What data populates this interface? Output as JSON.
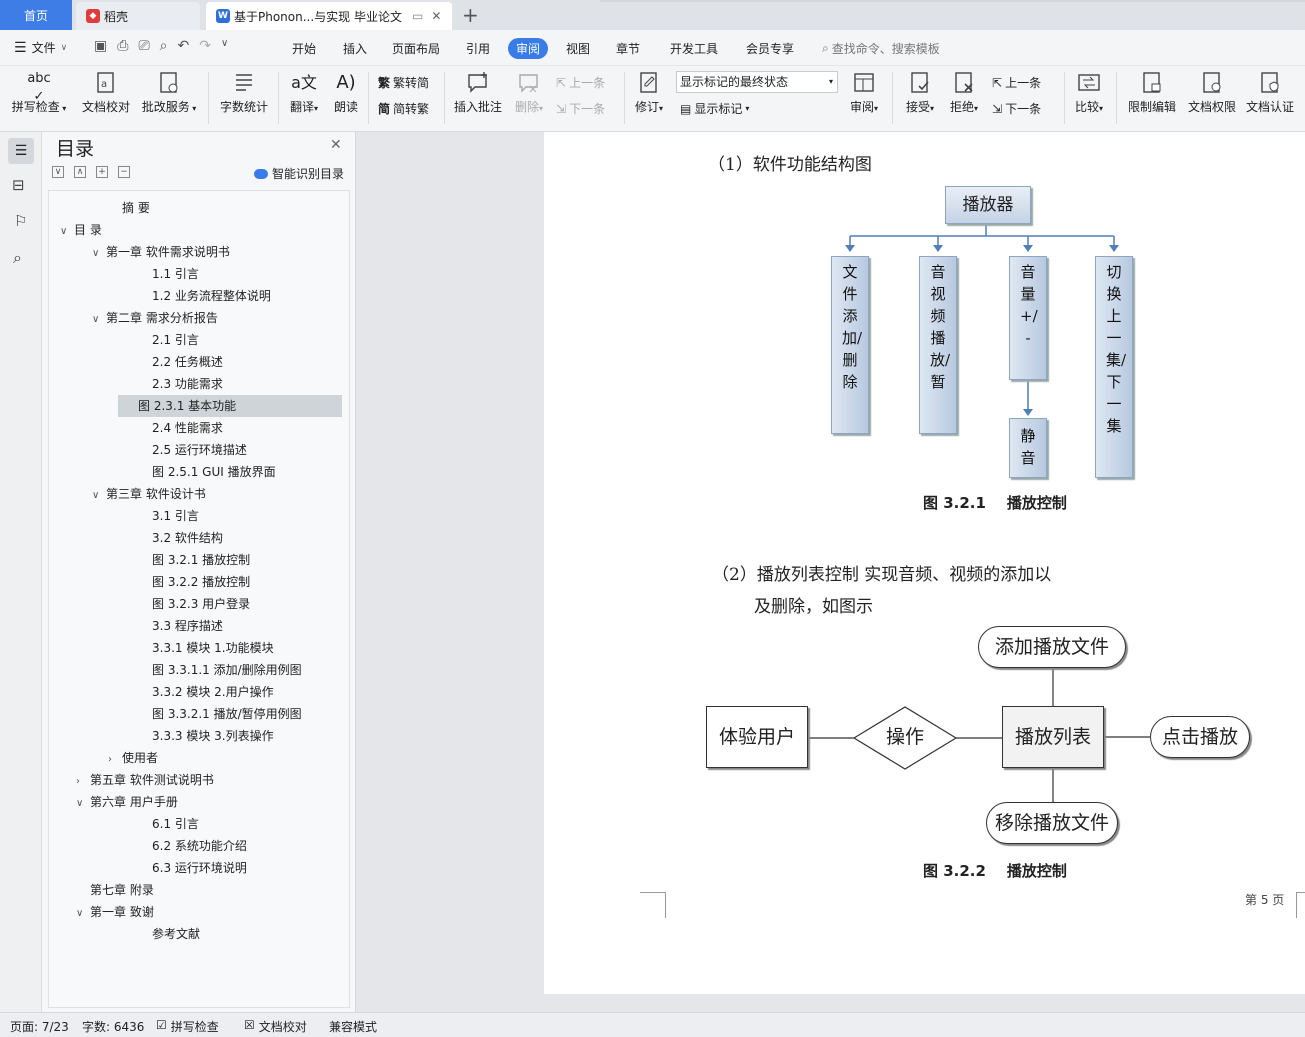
{
  "tabs": [
    {
      "label": "首页"
    },
    {
      "label": "稻壳"
    },
    {
      "label": "基于Phonon...与实现 毕业论文"
    }
  ],
  "menu": {
    "file": "文件",
    "items": [
      "开始",
      "插入",
      "页面布局",
      "引用",
      "审阅",
      "视图",
      "章节",
      "开发工具",
      "会员专享"
    ],
    "active": "审阅",
    "search_placeholder": "查找命令、搜索模板"
  },
  "ribbon": {
    "spellcheck": "拼写检查",
    "doc_check": "文档校对",
    "annotate_service": "批改服务",
    "word_count": "字数统计",
    "translate": "翻译",
    "read_aloud": "朗读",
    "trad_to_simp": "繁转简",
    "simp_to_trad": "简转繁",
    "insert_comment": "插入批注",
    "delete": "删除",
    "prev": "上一条",
    "next": "下一条",
    "revise": "修订",
    "markup_state": "显示标记的最终状态",
    "show_markup": "显示标记",
    "review": "审阅",
    "accept": "接受",
    "reject": "拒绝",
    "prev2": "上一条",
    "next2": "下一条",
    "compare": "比较",
    "restrict_edit": "限制编辑",
    "doc_permission": "文档权限",
    "doc_cert": "文档认证"
  },
  "toc": {
    "title": "目录",
    "smart_label": "智能识别目录",
    "items": [
      {
        "label": "摘  要",
        "level": 2,
        "chev": ""
      },
      {
        "label": "目  录",
        "level": 0,
        "chev": "v"
      },
      {
        "label": "第一章  软件需求说明书",
        "level": 1,
        "chev": "v"
      },
      {
        "label": "1.1 引言",
        "level": 3,
        "chev": ""
      },
      {
        "label": "1.2 业务流程整体说明",
        "level": 3,
        "chev": ""
      },
      {
        "label": "第二章  需求分析报告",
        "level": 1,
        "chev": "v"
      },
      {
        "label": "2.1 引言",
        "level": 3,
        "chev": ""
      },
      {
        "label": "2.2 任务概述",
        "level": 3,
        "chev": ""
      },
      {
        "label": "2.3 功能需求",
        "level": 3,
        "chev": ""
      },
      {
        "label": "图 2.3.1  基本功能",
        "level": 3,
        "chev": "",
        "selected": true
      },
      {
        "label": "2.4 性能需求",
        "level": 3,
        "chev": ""
      },
      {
        "label": "2.5 运行环境描述",
        "level": 3,
        "chev": ""
      },
      {
        "label": "图 2.5.1  GUI 播放界面",
        "level": 3,
        "chev": ""
      },
      {
        "label": "第三章  软件设计书",
        "level": 1,
        "chev": "v"
      },
      {
        "label": "3.1 引言",
        "level": 3,
        "chev": ""
      },
      {
        "label": "3.2 软件结构",
        "level": 3,
        "chev": ""
      },
      {
        "label": "图 3.2.1  播放控制",
        "level": 3,
        "chev": ""
      },
      {
        "label": "图 3.2.2  播放控制",
        "level": 3,
        "chev": ""
      },
      {
        "label": "图 3.2.3  用户登录",
        "level": 3,
        "chev": ""
      },
      {
        "label": "3.3 程序描述",
        "level": 3,
        "chev": ""
      },
      {
        "label": "3.3.1 模块 1.功能模块",
        "level": 3,
        "chev": ""
      },
      {
        "label": "图 3.3.1.1  添加/删除用例图",
        "level": 3,
        "chev": ""
      },
      {
        "label": "3.3.2 模块 2.用户操作",
        "level": 3,
        "chev": ""
      },
      {
        "label": "图 3.3.2.1  播放/暂停用例图",
        "level": 3,
        "chev": ""
      },
      {
        "label": "3.3.3 模块 3.列表操作",
        "level": 3,
        "chev": ""
      },
      {
        "label": "使用者",
        "level": 2,
        "chev": ">"
      },
      {
        "label": "第五章  软件测试说明书",
        "level": 0.5,
        "chev": ">"
      },
      {
        "label": "第六章  用户手册",
        "level": 0.5,
        "chev": "v"
      },
      {
        "label": "6.1 引言",
        "level": 3,
        "chev": ""
      },
      {
        "label": "6.2 系统功能介绍",
        "level": 3,
        "chev": ""
      },
      {
        "label": "6.3 运行环境说明",
        "level": 3,
        "chev": ""
      },
      {
        "label": "第七章  附录",
        "level": 0.5,
        "chev": ""
      },
      {
        "label": "第一章  致谢",
        "level": 0.5,
        "chev": "v"
      },
      {
        "label": "参考文献",
        "level": 3,
        "chev": ""
      }
    ]
  },
  "document": {
    "heading1": "（1）软件功能结构图",
    "diagram1": {
      "root": "播放器",
      "children": [
        "文件添加/删除",
        "音视频播放/暂",
        "音量+/-",
        "切换上一集/下一集"
      ],
      "sub": "静音",
      "caption": "图 3.2.1    播放控制"
    },
    "heading2_line1": "（2）播放列表控制  实现音频、视频的添加以",
    "heading2_line2": "及删除，如图示",
    "diagram2": {
      "actor": "体验用户",
      "action": "操作",
      "center": "播放列表",
      "top": "添加播放文件",
      "right": "点击播放",
      "bottom": "移除播放文件",
      "caption": "图 3.2.2    播放控制"
    },
    "page_number": "第 5 页"
  },
  "status": {
    "page": "页面: 7/23",
    "words": "字数: 6436",
    "spellcheck": "拼写检查",
    "doccheck": "文档校对",
    "compat": "兼容模式"
  }
}
